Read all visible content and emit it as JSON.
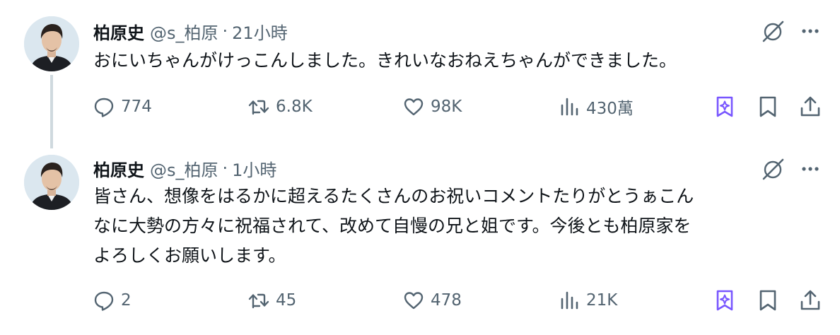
{
  "colors": {
    "text": "#0f1419",
    "secondary": "#536471",
    "accent": "#7856ff",
    "thread_line": "#cfd9de"
  },
  "tweets": [
    {
      "name": "柏原史",
      "handle": "@s_柏原",
      "separator": "·",
      "time": "21小時",
      "text_lines": [
        "おにいちゃんがけっこんしました。きれいなおねえちゃんができました。"
      ],
      "replies": "774",
      "retweets": "6.8K",
      "likes": "98K",
      "views": "430萬",
      "icons": {
        "more": "more-icon",
        "grok": "grok-icon",
        "reply": "reply-icon",
        "retweet": "retweet-icon",
        "like": "heart-icon",
        "views": "views-icon",
        "grok_bookmark": "grok-bookmark-icon",
        "bookmark": "bookmark-icon",
        "share": "share-icon"
      }
    },
    {
      "name": "柏原史",
      "handle": "@s_柏原",
      "separator": "·",
      "time": "1小時",
      "text_lines": [
        "皆さん、想像をはるかに超えるたくさんのお祝いコメントたりがとうぁこん",
        "なに大勢の方々に祝福されて、改めて自慢の兄と姐です。今後とも柏原家を",
        "よろしくお願いします。"
      ],
      "replies": "2",
      "retweets": "45",
      "likes": "478",
      "views": "21K"
    }
  ]
}
